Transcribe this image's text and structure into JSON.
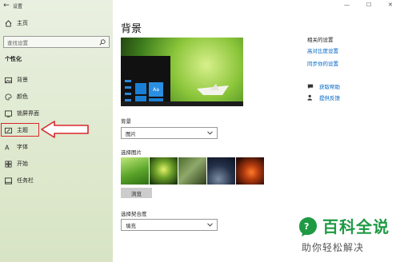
{
  "app": {
    "title": "设置"
  },
  "sidebar": {
    "home_label": "主页",
    "search_placeholder": "查找设置",
    "section_title": "个性化",
    "items": [
      {
        "label": "背景",
        "icon": "picture-icon"
      },
      {
        "label": "颜色",
        "icon": "palette-icon"
      },
      {
        "label": "锁屏界面",
        "icon": "lock-screen-icon"
      },
      {
        "label": "主题",
        "icon": "theme-icon",
        "highlighted": true
      },
      {
        "label": "字体",
        "icon": "font-icon"
      },
      {
        "label": "开始",
        "icon": "start-icon"
      },
      {
        "label": "任务栏",
        "icon": "taskbar-icon"
      }
    ]
  },
  "main": {
    "title": "背景",
    "preview": {
      "tile_text": "Aa"
    },
    "background": {
      "label": "背景",
      "value": "图片"
    },
    "choose_picture": {
      "label": "选择图片",
      "browse_label": "浏览"
    },
    "fit": {
      "label": "选择契合度",
      "value": "填充"
    }
  },
  "related": {
    "heading": "相关的设置",
    "links": [
      "高对比度设置",
      "同步你的设置"
    ],
    "help": [
      "获取帮助",
      "提供反馈"
    ]
  },
  "watermark": {
    "line1": "百科全说",
    "line2": "助你轻松解决"
  },
  "colors": {
    "accent": "#0066c6",
    "highlight": "#d9262b",
    "watermark": "#1f9a43"
  }
}
